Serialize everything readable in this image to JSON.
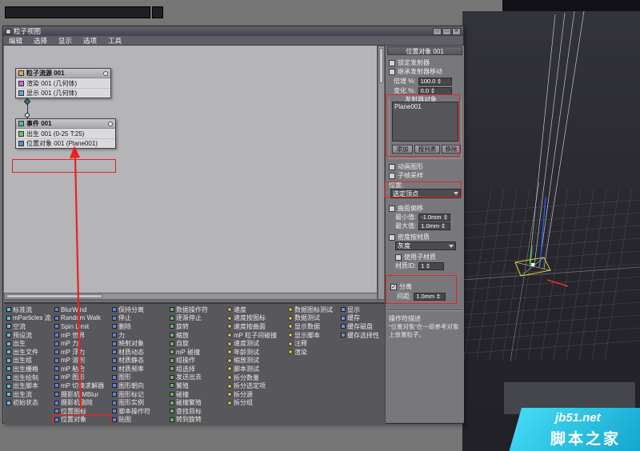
{
  "window": {
    "title": "粒子视图",
    "menus": [
      "编辑",
      "选择",
      "显示",
      "选项",
      "工具"
    ],
    "window_buttons": [
      "─",
      "□",
      "✕"
    ]
  },
  "canvas": {
    "source_node": {
      "title": "粒子流源 001",
      "rows": [
        "渲染 001 (几何体)",
        "显示 001 (几何体)"
      ]
    },
    "event_node": {
      "title": "事件 001",
      "rows": [
        "出生 001 (0-25 T:25)",
        "位置对象 001 (Plane001)"
      ]
    }
  },
  "depot": {
    "columns": [
      {
        "icon_color": "#58c8d8",
        "shape": "square",
        "items": [
          "标准流",
          "mParticles 流",
          "空流",
          "预设流",
          "出生",
          "出生文件",
          "出生组",
          "出生栅格",
          "出生绘制",
          "出生脚本",
          "出生流",
          "初始状态"
        ]
      },
      {
        "icon_color": "#5a86d8",
        "shape": "square",
        "items": [
          "BlurWind",
          "Random Walk",
          "Spin Limit",
          "mP 世界",
          "mP 力",
          "mP 浮力",
          "mP 溶剂",
          "mP 粘合",
          "mP 图形",
          "mP 切换求解器",
          "摄影机IMBlur",
          "摄影机剔除",
          "位置图标",
          {
            "label": "位置对象",
            "highlight": true
          }
        ]
      },
      {
        "icon_color": "#5a86d8",
        "shape": "square",
        "items": [
          "保持分离",
          "停止",
          "删除",
          "力",
          "映射对象",
          "材质动态",
          "材质静态",
          "材质频率",
          "图形",
          "图形朝向",
          "图形标记",
          "图形实例",
          "脚本操作符",
          "贴图"
        ]
      },
      {
        "icon_color": "#62b55a",
        "shape": "square",
        "items": [
          "数据操作符",
          "逐渐停止",
          "旋转",
          "缩放",
          "自旋",
          "mP 碰撞",
          "组操作",
          "组选择",
          "发送出去",
          "繁殖",
          "碰撞",
          "碰撞繁殖",
          "查找目标",
          "转到旋转"
        ]
      },
      {
        "icon_color": "#d8c84a",
        "shape": "diamond",
        "items": [
          "速度",
          "速度按图标",
          "速度按曲面",
          "mP 粒子间碰撞",
          "速度测试",
          "年龄测试",
          "缩放测试",
          "脚本测试",
          "拆分数量",
          "拆分选定项",
          "拆分源",
          "拆分组"
        ]
      },
      {
        "icon_color": "#d8c84a",
        "shape": "diamond",
        "items": [
          "数据图标测试",
          "数据测试",
          "显示数据",
          "显示脚本",
          "注释",
          "渲染"
        ]
      },
      {
        "icon_color": "#7a8ad8",
        "shape": "square",
        "items": [
          "显示",
          "缓存",
          "缓存磁盘",
          "缓存选择性"
        ]
      }
    ]
  },
  "panel": {
    "title": "位置对象 001",
    "lock_label": "锁定发射器",
    "lock_checked": false,
    "inherit_label": "继承发射器移动",
    "inherit_checked": false,
    "multiplier_label": "倍增 %:",
    "multiplier_value": "100.0",
    "variation_label": "变化 %:",
    "variation_value": "0.0",
    "emitter_group_label": "发射器对象",
    "emitter_list": [
      "Plane001"
    ],
    "btn_add": "添加",
    "btn_bylist": "按列表",
    "btn_remove": "移除",
    "animated_label": "动画图形",
    "animated_checked": false,
    "subframe_label": "子帧采样",
    "subframe_checked": false,
    "location_label": "位置:",
    "location_value": "选定顶点",
    "surface_offset_label": "曲面偏移",
    "surface_offset_checked": false,
    "min_label": "最小值:",
    "min_value": "-1.0mm",
    "max_label": "最大值:",
    "max_value": "1.0mm",
    "density_label": "密度按材质",
    "density_checked": false,
    "density_channel": "灰度",
    "submtl_label": "使用子材质",
    "submtl_checked": false,
    "matid_label": "材质ID:",
    "matid_value": "1",
    "apart_label": "分离",
    "apart_checked": true,
    "distance_label": "间距:",
    "distance_value": "1.0mm",
    "desc_title": "操作符描述",
    "desc_text": "“位置对象”在一组参考对象上放置粒子。"
  },
  "logo": {
    "line1": "jb51.net",
    "line2": "脚本之家",
    "color": "#17b3dc"
  },
  "annotation_color": "#e82222"
}
